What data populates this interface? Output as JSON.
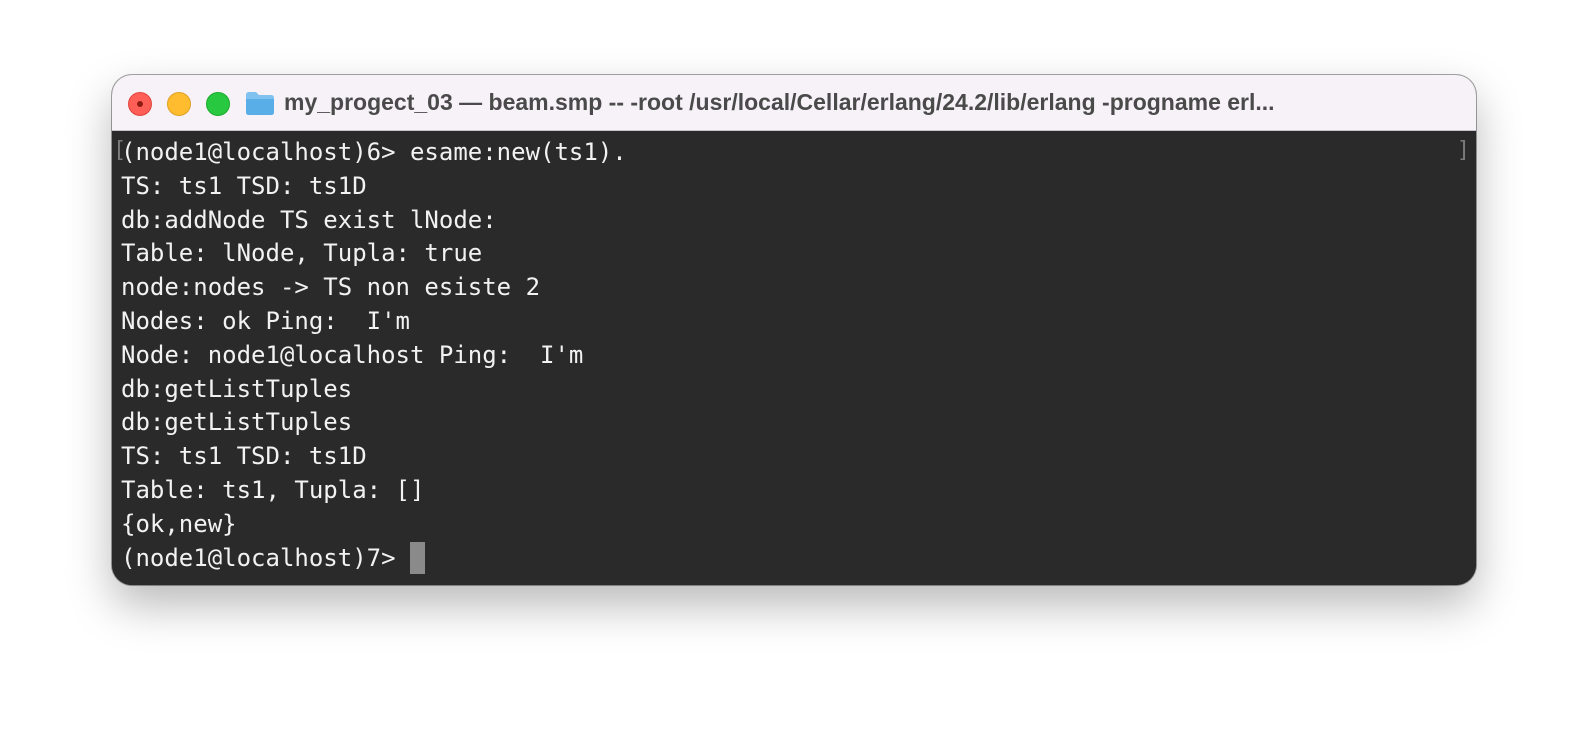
{
  "window": {
    "title": "my_progect_03 — beam.smp -- -root /usr/local/Cellar/erlang/24.2/lib/erlang -progname erl..."
  },
  "terminal": {
    "lines": [
      "(node1@localhost)6> esame:new(ts1).",
      "TS: ts1 TSD: ts1D",
      "db:addNode TS exist lNode:",
      "Table: lNode, Tupla: true",
      "node:nodes -> TS non esiste 2",
      "Nodes: ok Ping:  I'm",
      "Node: node1@localhost Ping:  I'm",
      "db:getListTuples",
      "db:getListTuples",
      "TS: ts1 TSD: ts1D",
      "Table: ts1, Tupla: []",
      "{ok,new}"
    ],
    "prompt": "(node1@localhost)7>",
    "left_marker": "[",
    "right_marker": "]"
  },
  "icons": {
    "close": "close-button-icon",
    "minimize": "minimize-button-icon",
    "zoom": "zoom-button-icon",
    "folder": "folder-icon"
  },
  "colors": {
    "terminal_background": "#2a2a2a",
    "terminal_text": "#f2f2f2",
    "titlebar_background": "#f6f2f8",
    "close": "#ff5f57",
    "minimize": "#febc2e",
    "zoom": "#28c840",
    "cursor": "#8a8a8a"
  }
}
